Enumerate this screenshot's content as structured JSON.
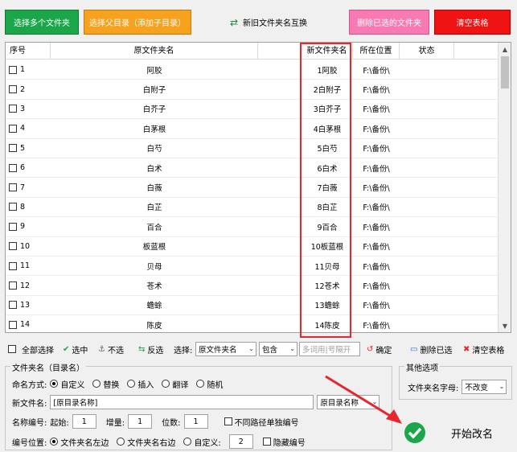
{
  "toolbar": {
    "select_multi": "选择多个文件夹",
    "select_parent": "选择父目录（添加子目录）",
    "swap": "新旧文件夹名互换",
    "delete_selected": "删除已选的文件夹",
    "clear_table": "清空表格"
  },
  "table": {
    "headers": [
      "序号",
      "原文件夹名",
      "新文件夹名",
      "所在位置",
      "状态"
    ],
    "rows": [
      {
        "no": "1",
        "old": "阿胶",
        "new": "1阿胶",
        "loc": "F:\\备份\\",
        "status": ""
      },
      {
        "no": "2",
        "old": "白附子",
        "new": "2白附子",
        "loc": "F:\\备份\\",
        "status": ""
      },
      {
        "no": "3",
        "old": "白芥子",
        "new": "3白芥子",
        "loc": "F:\\备份\\",
        "status": ""
      },
      {
        "no": "4",
        "old": "白茅根",
        "new": "4白茅根",
        "loc": "F:\\备份\\",
        "status": ""
      },
      {
        "no": "5",
        "old": "白芍",
        "new": "5白芍",
        "loc": "F:\\备份\\",
        "status": ""
      },
      {
        "no": "6",
        "old": "白术",
        "new": "6白术",
        "loc": "F:\\备份\\",
        "status": ""
      },
      {
        "no": "7",
        "old": "白薇",
        "new": "7白薇",
        "loc": "F:\\备份\\",
        "status": ""
      },
      {
        "no": "8",
        "old": "白芷",
        "new": "8白芷",
        "loc": "F:\\备份\\",
        "status": ""
      },
      {
        "no": "9",
        "old": "百合",
        "new": "9百合",
        "loc": "F:\\备份\\",
        "status": ""
      },
      {
        "no": "10",
        "old": "板蓝根",
        "new": "10板蓝根",
        "loc": "F:\\备份\\",
        "status": ""
      },
      {
        "no": "11",
        "old": "贝母",
        "new": "11贝母",
        "loc": "F:\\备份\\",
        "status": ""
      },
      {
        "no": "12",
        "old": "苍术",
        "new": "12苍术",
        "loc": "F:\\备份\\",
        "status": ""
      },
      {
        "no": "13",
        "old": "蟾蜍",
        "new": "13蟾蜍",
        "loc": "F:\\备份\\",
        "status": ""
      },
      {
        "no": "14",
        "old": "陈皮",
        "new": "14陈皮",
        "loc": "F:\\备份\\",
        "status": ""
      }
    ]
  },
  "filter": {
    "select_all": "全部选择",
    "select": "选中",
    "deselect": "不选",
    "invert": "反选",
    "choose_label": "选择:",
    "field_value": "原文件夹名",
    "match_value": "包含",
    "keyword_placeholder": "多词用|号隔开",
    "confirm": "确定",
    "delete_selected": "删除已选",
    "clear_table": "清空表格"
  },
  "naming": {
    "group_title": "文件夹名（目录名）",
    "mode_label": "命名方式:",
    "modes": [
      "自定义",
      "替换",
      "插入",
      "翻译",
      "随机"
    ],
    "new_name_label": "新文件名:",
    "new_name_value": "[原目录名称]",
    "new_name_dropdown": "原目录名称",
    "number_label": "名称编号:",
    "start_label": "起始:",
    "start_value": "1",
    "step_label": "增量:",
    "step_value": "1",
    "digits_label": "位数:",
    "digits_value": "1",
    "separate_label": "不同路径单独编号",
    "position_label": "编号位置:",
    "positions": [
      "文件夹名左边",
      "文件夹名右边",
      "自定义:"
    ],
    "custom_pos_value": "2",
    "hide_number_label": "隐藏编号"
  },
  "other": {
    "group_title": "其他选项",
    "case_label": "文件夹名字母:",
    "case_value": "不改变"
  },
  "start": {
    "label": "开始改名"
  }
}
